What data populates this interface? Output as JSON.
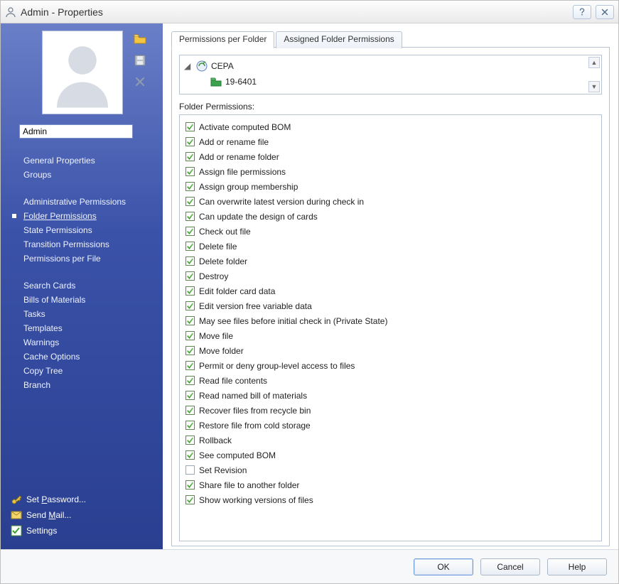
{
  "title": "Admin - Properties",
  "sidebar": {
    "name_value": "Admin",
    "nav": [
      "General Properties",
      "Groups",
      "",
      "Administrative Permissions",
      "Folder Permissions",
      "State Permissions",
      "Transition Permissions",
      "Permissions per File",
      "",
      "Search Cards",
      "Bills of Materials",
      "Tasks",
      "Templates",
      "Warnings",
      "Cache Options",
      "Copy Tree",
      "Branch"
    ],
    "selected_index": 4,
    "bottom": {
      "set_password": "Set Password...",
      "send_mail": "Send Mail...",
      "settings": "Settings"
    }
  },
  "tabs": {
    "active": 0,
    "items": [
      "Permissions per Folder",
      "Assigned Folder Permissions"
    ]
  },
  "tree": {
    "root_label": "CEPA",
    "child_label": "19-6401"
  },
  "section_label": "Folder Permissions:",
  "permissions": [
    {
      "label": "Activate computed BOM",
      "checked": true
    },
    {
      "label": "Add or rename file",
      "checked": true
    },
    {
      "label": "Add or rename folder",
      "checked": true
    },
    {
      "label": "Assign file permissions",
      "checked": true
    },
    {
      "label": "Assign group membership",
      "checked": true
    },
    {
      "label": "Can overwrite latest version during check in",
      "checked": true
    },
    {
      "label": "Can update the design of cards",
      "checked": true
    },
    {
      "label": "Check out file",
      "checked": true
    },
    {
      "label": "Delete file",
      "checked": true
    },
    {
      "label": "Delete folder",
      "checked": true
    },
    {
      "label": "Destroy",
      "checked": true
    },
    {
      "label": "Edit folder card data",
      "checked": true
    },
    {
      "label": "Edit version free variable data",
      "checked": true
    },
    {
      "label": "May see files before initial check in (Private State)",
      "checked": true
    },
    {
      "label": "Move file",
      "checked": true
    },
    {
      "label": "Move folder",
      "checked": true
    },
    {
      "label": "Permit or deny group-level access to files",
      "checked": true
    },
    {
      "label": "Read file contents",
      "checked": true
    },
    {
      "label": "Read named bill of materials",
      "checked": true
    },
    {
      "label": "Recover files from recycle bin",
      "checked": true
    },
    {
      "label": "Restore file from cold storage",
      "checked": true
    },
    {
      "label": "Rollback",
      "checked": true
    },
    {
      "label": "See computed BOM",
      "checked": true
    },
    {
      "label": "Set Revision",
      "checked": false
    },
    {
      "label": "Share file to another folder",
      "checked": true
    },
    {
      "label": "Show working versions of files",
      "checked": true
    }
  ],
  "footer": {
    "ok": "OK",
    "cancel": "Cancel",
    "help": "Help"
  }
}
